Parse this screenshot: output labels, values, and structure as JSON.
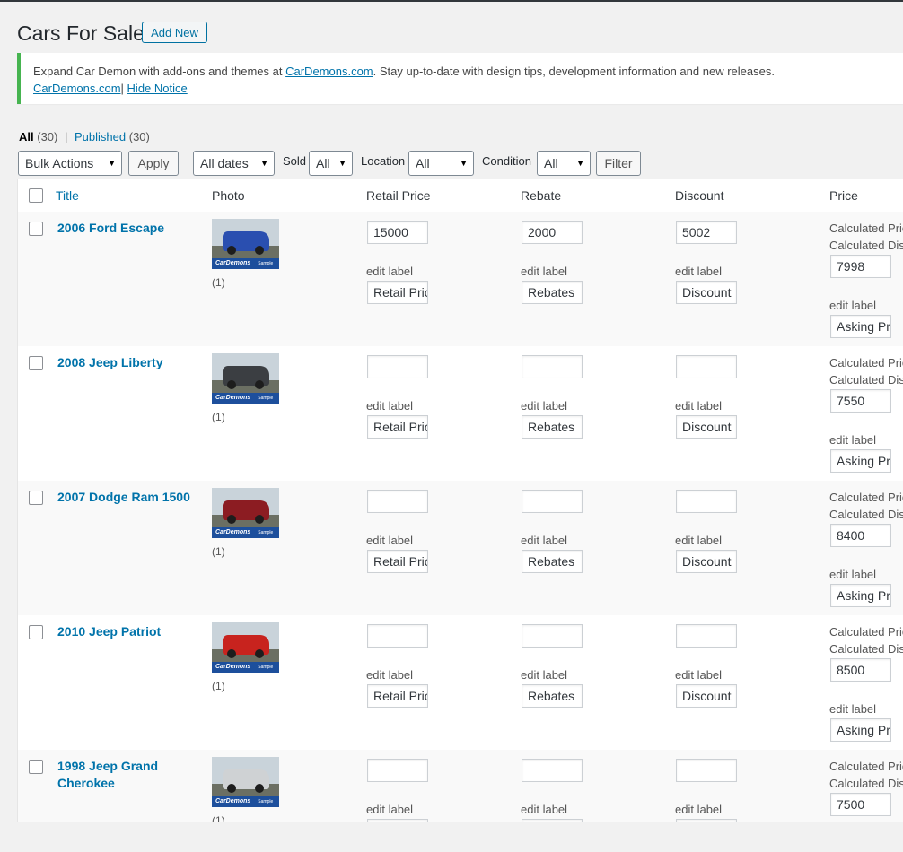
{
  "page": {
    "title": "Cars For Sale",
    "add_new": "Add New"
  },
  "notice": {
    "text_before": "Expand Car Demon with add-ons and themes at ",
    "link1": "CarDemons.com",
    "text_after": ". Stay up-to-date with design tips, development information and new releases.",
    "link2": "CarDemons.com",
    "separator": "|",
    "hide": "Hide Notice"
  },
  "views": {
    "all_label": "All",
    "all_count": "(30)",
    "sep": "|",
    "published_label": "Published",
    "published_count": "(30)"
  },
  "filters": {
    "bulk_actions": "Bulk Actions",
    "apply": "Apply",
    "dates": "All dates",
    "sold_label": "Sold",
    "sold_value": "All",
    "location_label": "Location",
    "location_value": "All",
    "condition_label": "Condition",
    "condition_value": "All",
    "filter": "Filter"
  },
  "columns": {
    "title": "Title",
    "photo": "Photo",
    "retail_price": "Retail Price",
    "rebate": "Rebate",
    "discount": "Discount",
    "price": "Price"
  },
  "row_labels": {
    "edit_label": "edit label",
    "retail_label_value": "Retail Price",
    "rebates_label_value": "Rebates",
    "discount_label_value": "Discount",
    "asking_label_value": "Asking Price",
    "calc_price": "Calculated Price",
    "calc_discount": "Calculated Discount",
    "photo_banner": "CarDemons",
    "photo_sub": "Sample Inventory Vehicle"
  },
  "rows": [
    {
      "title": "2006 Ford Escape",
      "photo_count": "(1)",
      "retail": "15000",
      "rebate": "2000",
      "discount": "5002",
      "price": "7998",
      "car_color": "#2a4fb0"
    },
    {
      "title": "2008 Jeep Liberty",
      "photo_count": "(1)",
      "retail": "",
      "rebate": "",
      "discount": "",
      "price": "7550",
      "car_color": "#3b3e42"
    },
    {
      "title": "2007 Dodge Ram 1500",
      "photo_count": "(1)",
      "retail": "",
      "rebate": "",
      "discount": "",
      "price": "8400",
      "car_color": "#8c1c22"
    },
    {
      "title": "2010 Jeep Patriot",
      "photo_count": "(1)",
      "retail": "",
      "rebate": "",
      "discount": "",
      "price": "8500",
      "car_color": "#c8231e"
    },
    {
      "title": "1998 Jeep Grand Cherokee",
      "photo_count": "(1)",
      "retail": "",
      "rebate": "",
      "discount": "",
      "price": "7500",
      "car_color": "#cfd2d4"
    }
  ]
}
